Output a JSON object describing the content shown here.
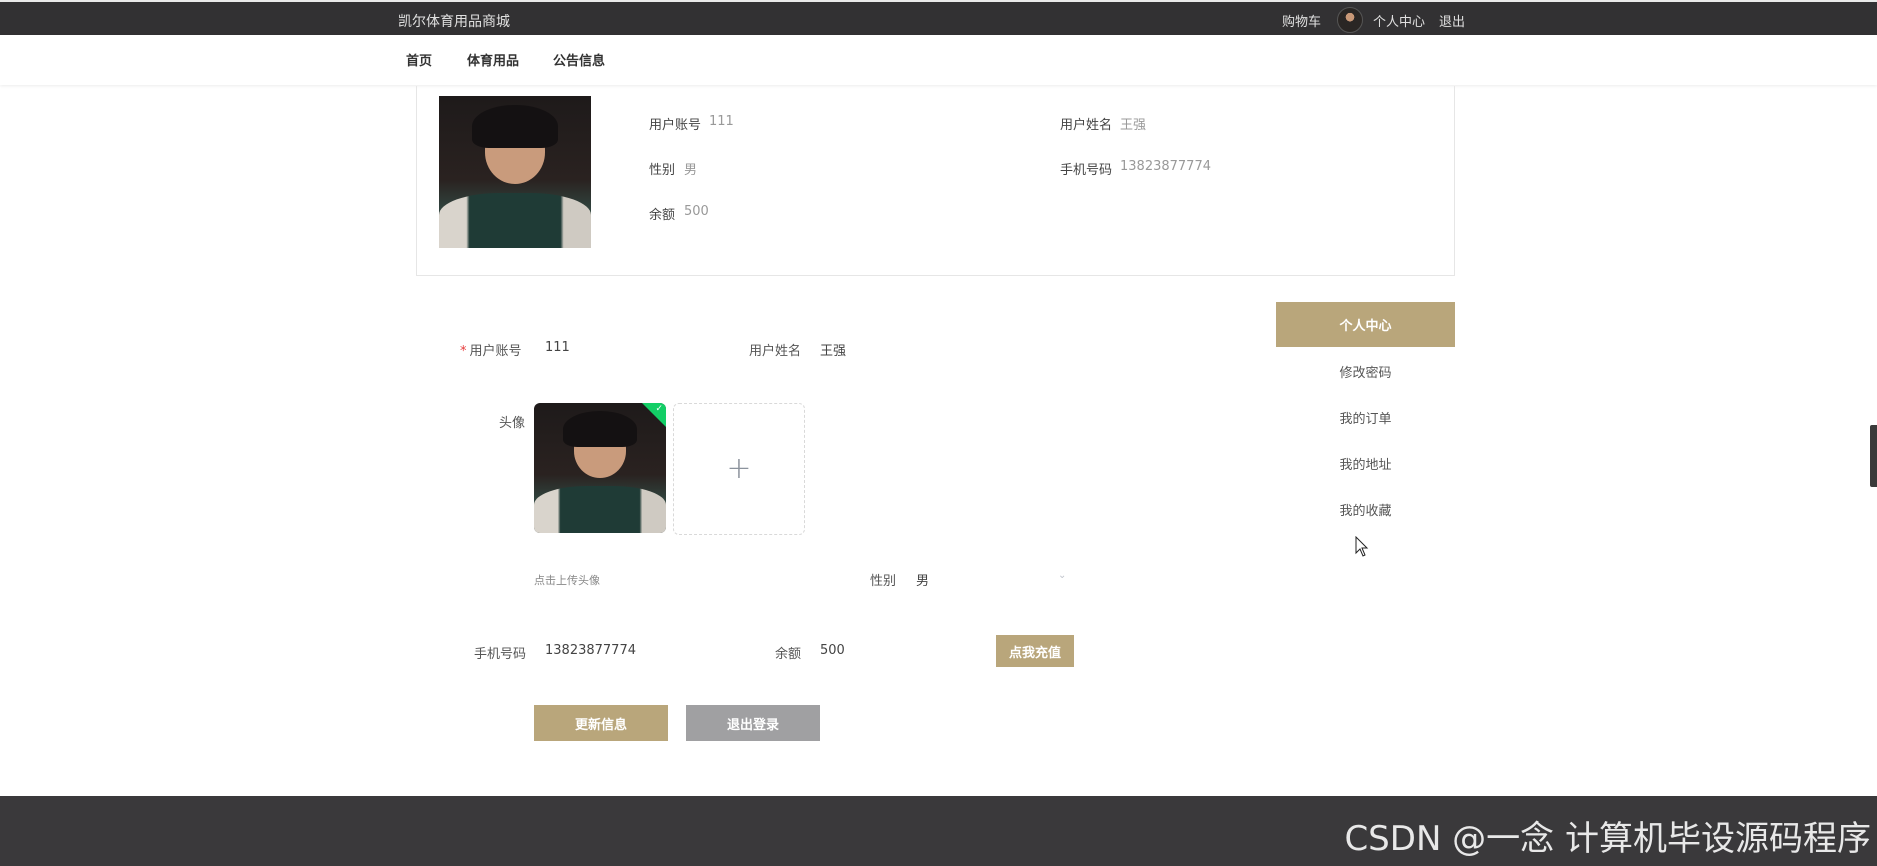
{
  "header": {
    "site_title": "凯尔体育用品商城",
    "cart": "购物车",
    "user_center": "个人中心",
    "logout": "退出"
  },
  "nav": {
    "home": "首页",
    "sports_goods": "体育用品",
    "notices": "公告信息"
  },
  "profile": {
    "account_label": "用户账号",
    "account_value": "111",
    "name_label": "用户姓名",
    "name_value": "王强",
    "gender_label": "性别",
    "gender_value": "男",
    "phone_label": "手机号码",
    "phone_value": "13823877774",
    "balance_label": "余额",
    "balance_value": "500"
  },
  "form": {
    "required_mark": "*",
    "account_label": "用户账号",
    "account_value": "111",
    "name_label": "用户姓名",
    "name_value": "王强",
    "avatar_label": "头像",
    "upload_plus": "+",
    "upload_hint": "点击上传头像",
    "gender_label": "性别",
    "gender_value": "男",
    "phone_label": "手机号码",
    "phone_value": "13823877774",
    "balance_label": "余额",
    "balance_value": "500",
    "recharge_button": "点我充值",
    "update_button": "更新信息",
    "logout_button": "退出登录"
  },
  "side_menu": {
    "active": "个人中心",
    "items": [
      "修改密码",
      "我的订单",
      "我的地址",
      "我的收藏"
    ]
  },
  "footer": {
    "watermark": "CSDN @一念 计算机毕设源码程序"
  },
  "colors": {
    "accent": "#b9a67b",
    "topbar": "#323133",
    "footer": "#3a393b",
    "upload_success": "#13ce66"
  }
}
